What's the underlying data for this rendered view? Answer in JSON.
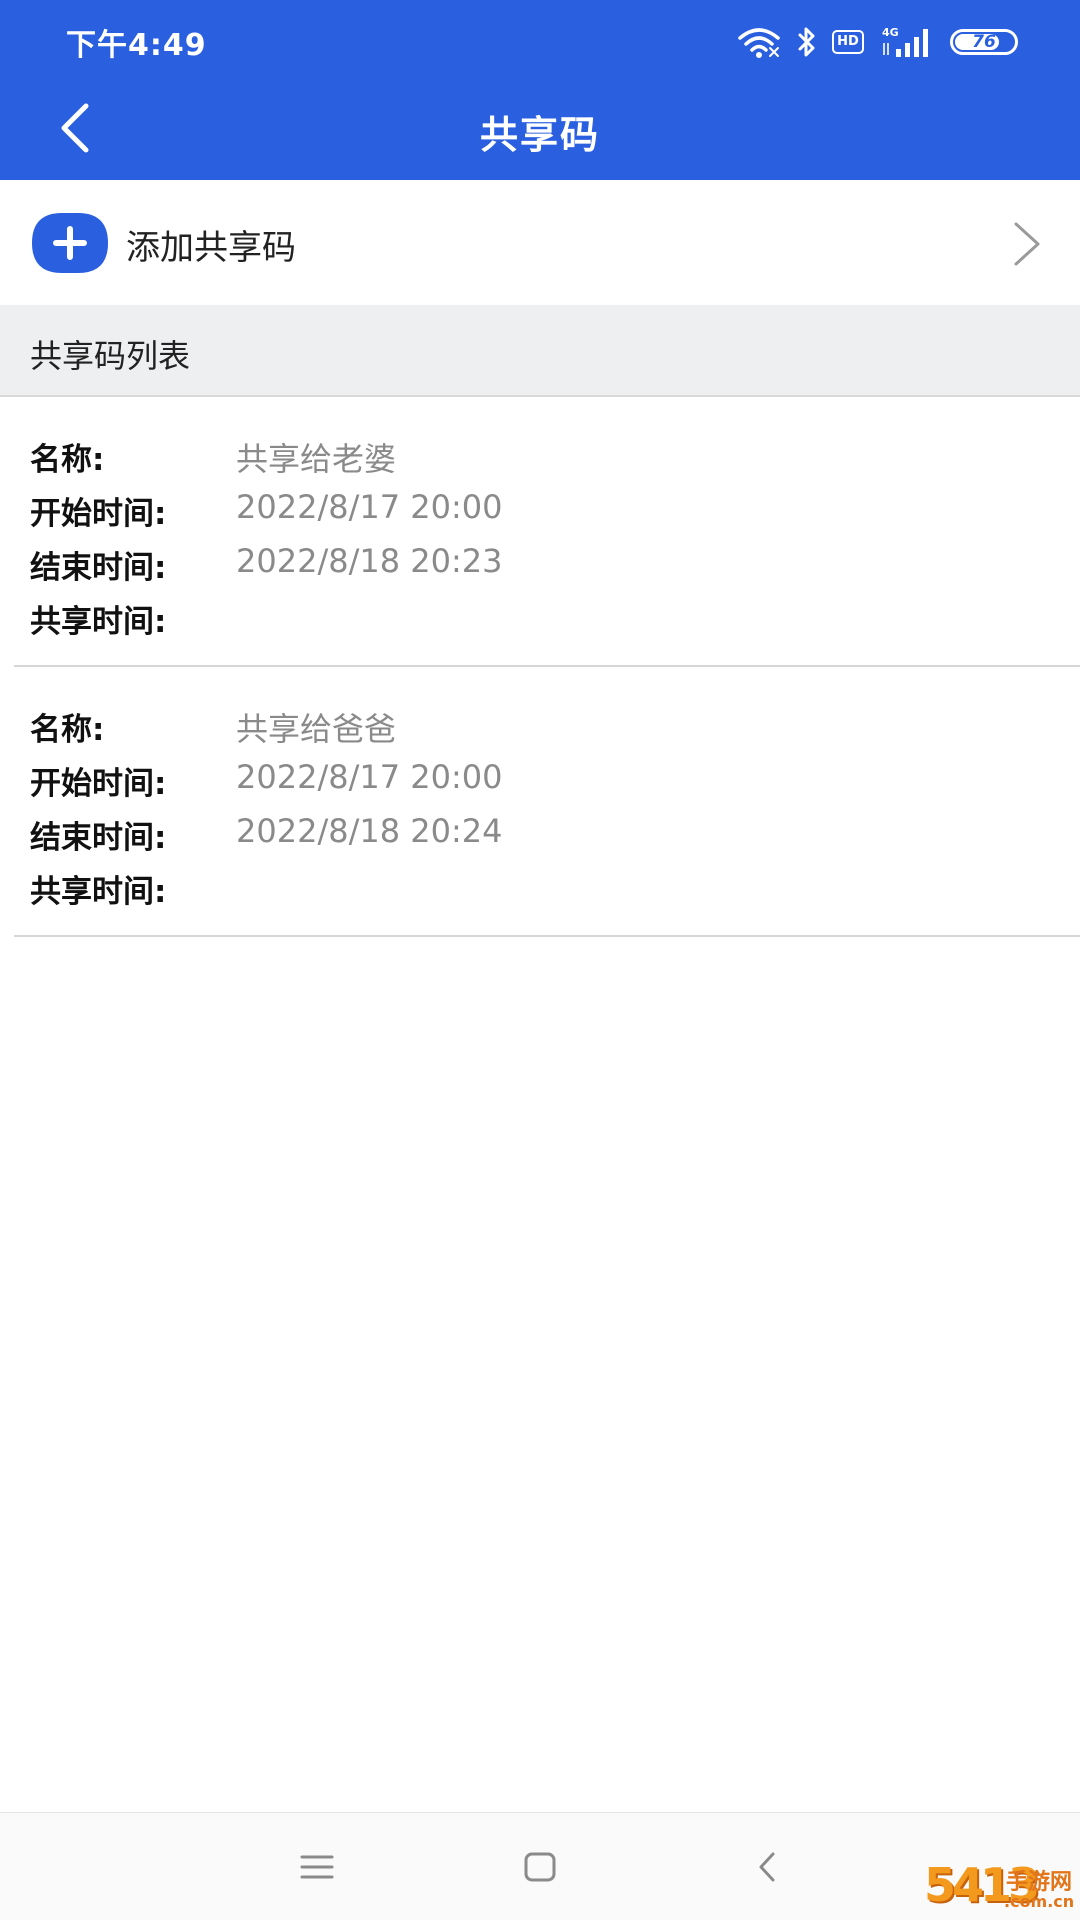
{
  "status_bar": {
    "time": "下午4:49",
    "hd_label": "HD",
    "network_label": "4G",
    "battery_level": "76",
    "battery_fraction": 0.76
  },
  "header": {
    "title": "共享码",
    "back_icon": "chevron-left-icon"
  },
  "add_row": {
    "label": "添加共享码",
    "icon": "plus-circle-icon",
    "chevron_icon": "chevron-right-icon",
    "accent_color": "#2a5fe0"
  },
  "section": {
    "title": "共享码列表"
  },
  "list": {
    "items": [
      {
        "name_label": "名称:",
        "name": "共享给老婆",
        "start_label": "开始时间:",
        "start": "2022/8/17 20:00",
        "end_label": "结束时间:",
        "end": "2022/8/18 20:23",
        "share_label": "共享时间:",
        "share": ""
      },
      {
        "name_label": "名称:",
        "name": "共享给爸爸",
        "start_label": "开始时间:",
        "start": "2022/8/17 20:00",
        "end_label": "结束时间:",
        "end": "2022/8/18 20:24",
        "share_label": "共享时间:",
        "share": ""
      }
    ]
  },
  "nav": {
    "menu_icon": "menu-icon",
    "home_icon": "home-square-icon",
    "back_icon": "back-triangle-icon"
  },
  "watermark": {
    "number": "5413",
    "text": "手游网",
    "sub": ".com.cn"
  },
  "colors": {
    "header_bg": "#2a5fe0",
    "section_bg": "#eeeff1",
    "value_text": "#8a8a8a"
  }
}
